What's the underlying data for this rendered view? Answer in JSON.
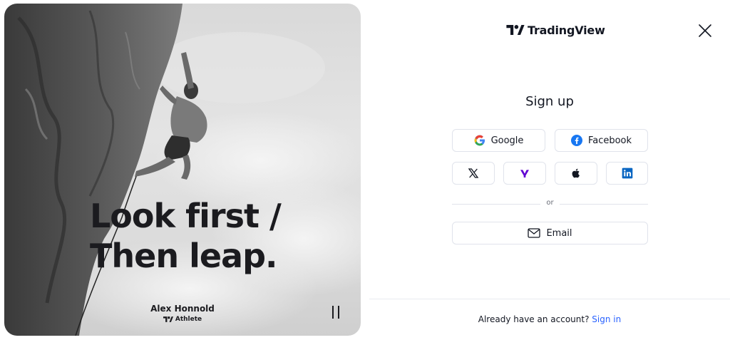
{
  "hero": {
    "slogan_line1": "Look first /",
    "slogan_line2": "Then leap.",
    "athlete_name": "Alex Honnold",
    "athlete_label": "Athlete",
    "pause_icon": "pause-icon"
  },
  "header": {
    "brand": "TradingView",
    "logo_icon": "tradingview-logo-icon",
    "close_icon": "close-icon"
  },
  "signup": {
    "title": "Sign up",
    "google_label": "Google",
    "facebook_label": "Facebook",
    "social_icons": [
      "x-icon",
      "yahoo-icon",
      "apple-icon",
      "linkedin-icon"
    ],
    "or_label": "or",
    "email_label": "Email"
  },
  "footer": {
    "question": "Already have an account?",
    "signin_label": "Sign in"
  },
  "colors": {
    "link": "#2962ff",
    "border": "#e0e3eb",
    "text": "#131722",
    "facebook": "#1877f2",
    "yahoo": "#6001d2",
    "linkedin": "#0a66c2"
  }
}
